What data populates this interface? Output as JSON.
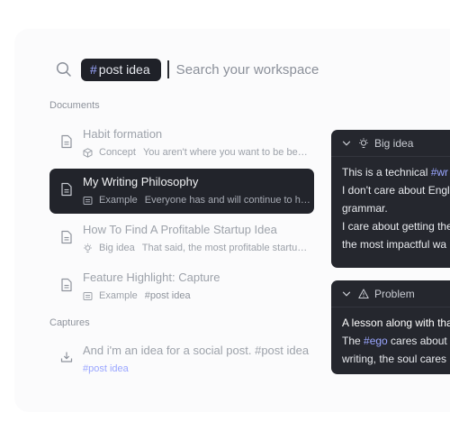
{
  "search": {
    "tag_hash": "#",
    "tag_label": "post idea",
    "placeholder": "Search your workspace"
  },
  "sections": {
    "documents": "Documents",
    "captures": "Captures"
  },
  "documents": [
    {
      "title": "Habit formation",
      "type": "Concept",
      "snippet": "You aren't where you want to be becau..."
    },
    {
      "title": "My Writing Philosophy",
      "type": "Example",
      "snippet": "Everyone has and will continue to have..."
    },
    {
      "title": "How To Find A Profitable Startup Idea",
      "type": "Big idea",
      "snippet": "That said, the most profitable startup id..."
    },
    {
      "title": "Feature Highlight: Capture",
      "type": "Example",
      "snippet": "#post idea"
    }
  ],
  "captures": [
    {
      "title": "And i'm an idea for a social post. #post idea",
      "tag": "#post idea"
    }
  ],
  "cards": {
    "big_idea": {
      "title": "Big idea",
      "line1_text": "This is a technical ",
      "line1_link": "#wr",
      "line2": "I don't care about Engl",
      "line3": "grammar.",
      "line4": "I care about getting the",
      "line5": "the most impactful wa"
    },
    "problem": {
      "title": "Problem",
      "line1": "A lesson along with tha",
      "line2_text": "The ",
      "line2_link": "#ego",
      "line2_rest": " cares about",
      "line3": "writing, the soul cares"
    }
  }
}
